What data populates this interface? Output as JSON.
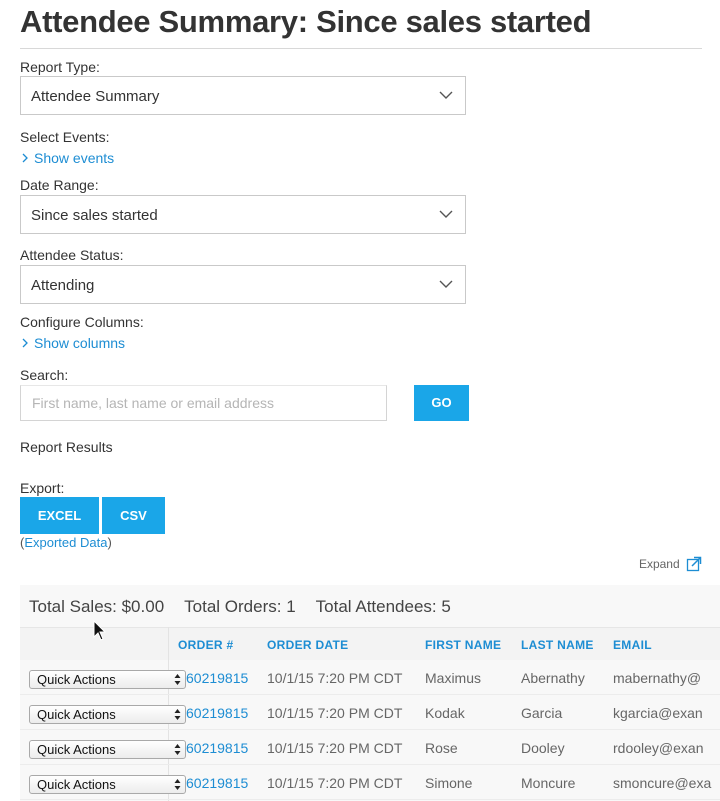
{
  "page": {
    "title": "Attendee Summary: Since sales started"
  },
  "form": {
    "report_type": {
      "label": "Report Type:",
      "value": "Attendee Summary"
    },
    "select_events": {
      "label": "Select Events:",
      "link": "Show events"
    },
    "date_range": {
      "label": "Date Range:",
      "value": "Since sales started"
    },
    "attendee_status": {
      "label": "Attendee Status:",
      "value": "Attending"
    },
    "configure_columns": {
      "label": "Configure Columns:",
      "link": "Show columns"
    },
    "search": {
      "label": "Search:",
      "placeholder": "First name, last name or email address",
      "go_label": "GO"
    }
  },
  "report_results": {
    "heading": "Report Results",
    "export_label": "Export:",
    "excel_label": "EXCEL",
    "csv_label": "CSV",
    "exported_open": "(",
    "exported_link": "Exported Data",
    "exported_close": ")",
    "expand_label": "Expand"
  },
  "totals": {
    "sales": "Total Sales: $0.00",
    "orders": "Total Orders: 1",
    "attendees": "Total Attendees: 5"
  },
  "table": {
    "columns": [
      "ORDER #",
      "ORDER DATE",
      "FIRST NAME",
      "LAST NAME",
      "EMAIL"
    ],
    "quick_actions_label": "Quick Actions",
    "rows": [
      {
        "order": "60219815",
        "date": "10/1/15 7:20 PM CDT",
        "first": "Maximus",
        "last": "Abernathy",
        "email": "mabernathy@"
      },
      {
        "order": "60219815",
        "date": "10/1/15 7:20 PM CDT",
        "first": "Kodak",
        "last": "Garcia",
        "email": "kgarcia@exan"
      },
      {
        "order": "60219815",
        "date": "10/1/15 7:20 PM CDT",
        "first": "Rose",
        "last": "Dooley",
        "email": "rdooley@exan"
      },
      {
        "order": "60219815",
        "date": "10/1/15 7:20 PM CDT",
        "first": "Simone",
        "last": "Moncure",
        "email": "smoncure@exa"
      }
    ]
  },
  "colors": {
    "accent": "#1aa6e8",
    "link": "#1d8dd3"
  },
  "icons": {
    "select_chevron": "chevron-down-icon",
    "link_chevron": "chevron-right-icon",
    "expand": "expand-icon",
    "cursor": "mouse-pointer-icon"
  }
}
